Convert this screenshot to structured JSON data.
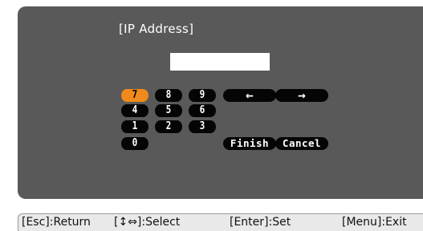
{
  "dialog": {
    "title": "[IP Address]",
    "ip_value": ""
  },
  "keypad": {
    "digits": [
      {
        "label": "7",
        "selected": true
      },
      {
        "label": "8",
        "selected": false
      },
      {
        "label": "9",
        "selected": false
      },
      {
        "label": "4",
        "selected": false
      },
      {
        "label": "5",
        "selected": false
      },
      {
        "label": "6",
        "selected": false
      },
      {
        "label": "1",
        "selected": false
      },
      {
        "label": "2",
        "selected": false
      },
      {
        "label": "3",
        "selected": false
      },
      {
        "label": "0",
        "selected": false
      }
    ],
    "left_arrow": "←",
    "right_arrow": "→",
    "finish_label": "Finish",
    "cancel_label": "Cancel",
    "selected_color": "#f08a1a",
    "key_color": "#050505"
  },
  "status_bar": {
    "esc_hint": "[Esc]:Return",
    "select_hint": "[↕⇔]:Select",
    "enter_hint": "[Enter]:Set",
    "menu_hint": "[Menu]:Exit"
  },
  "colors": {
    "panel": "#595959",
    "status_bar": "#e9e9e9"
  }
}
